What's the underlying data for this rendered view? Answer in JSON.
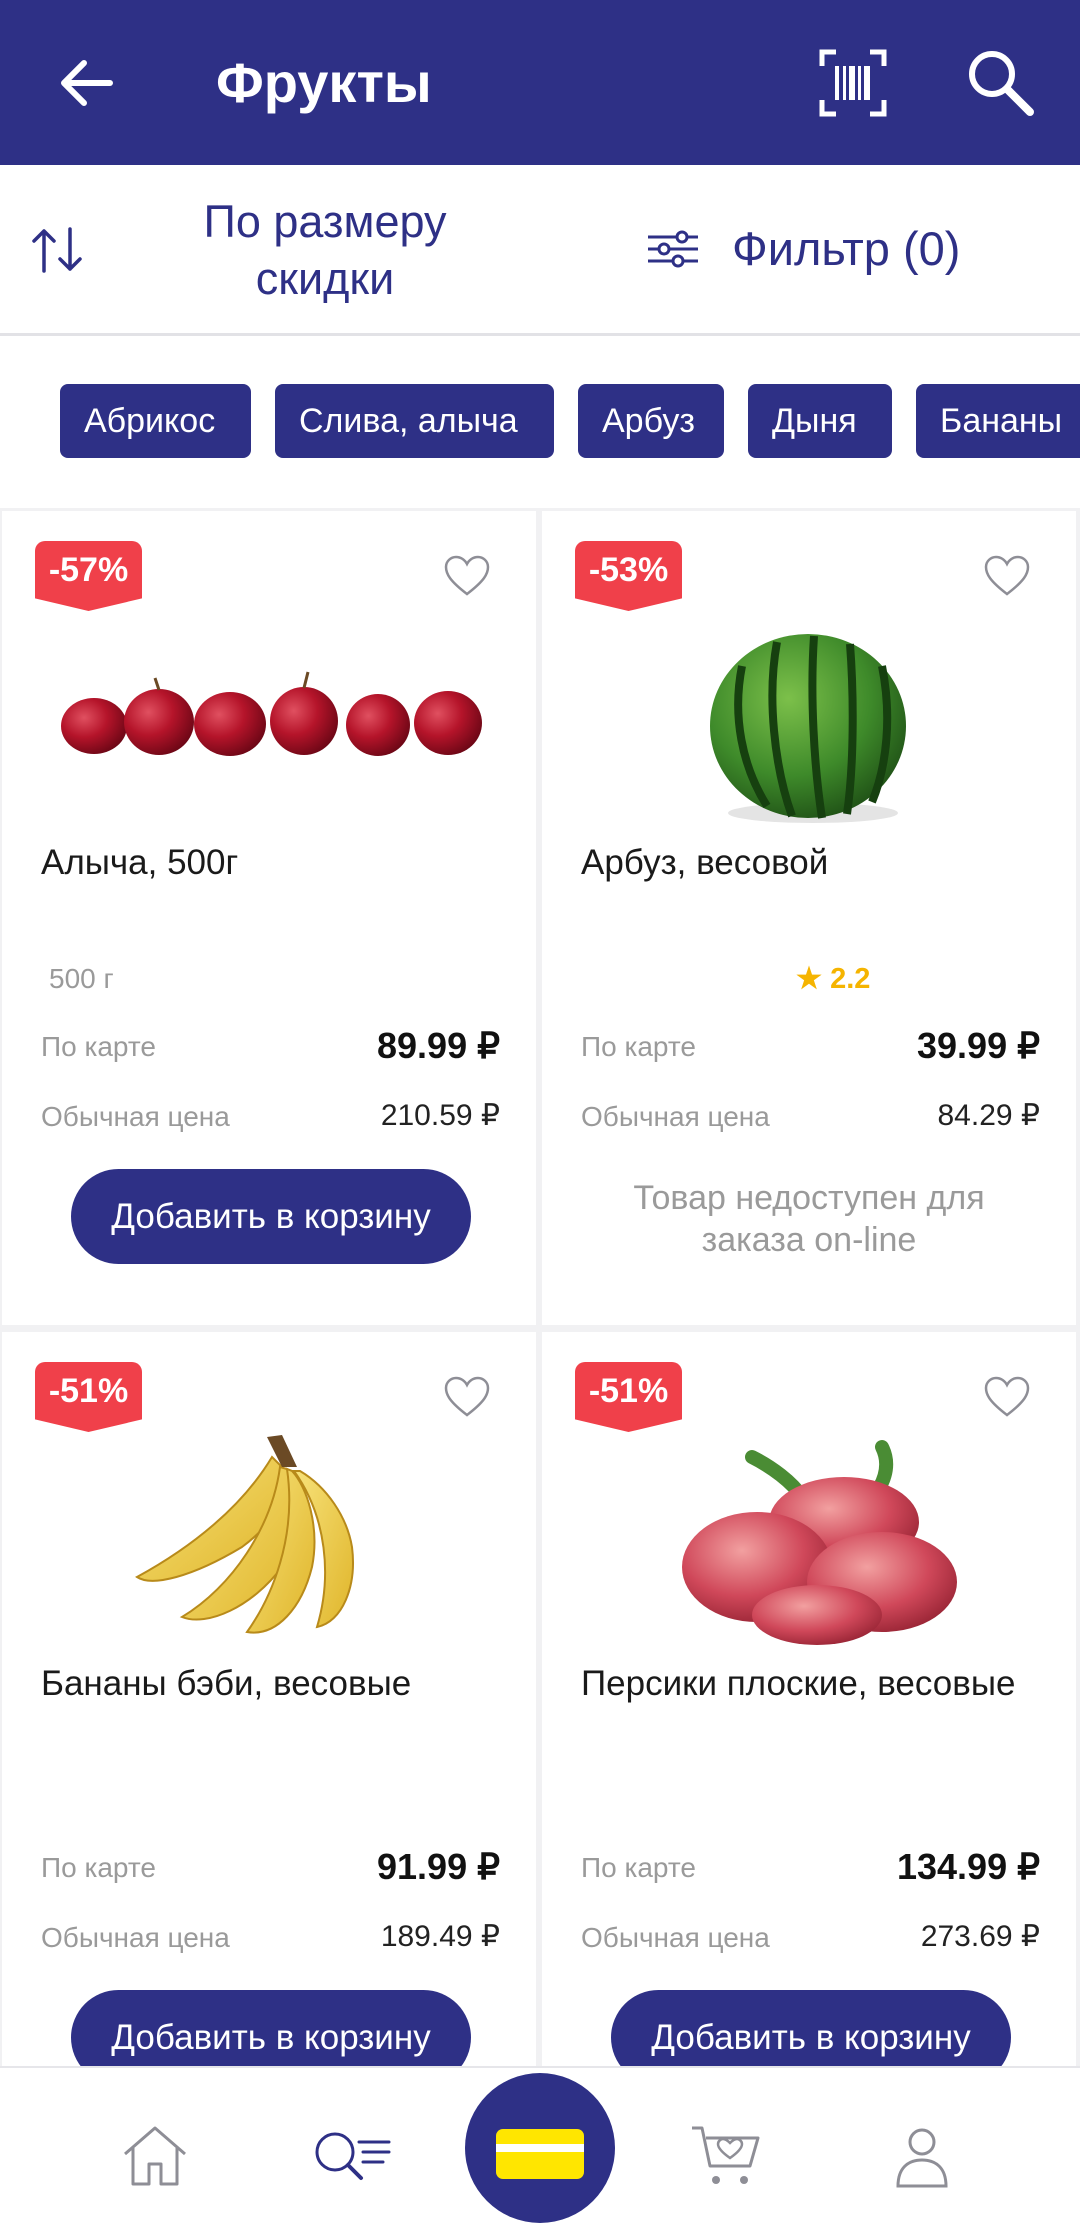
{
  "header": {
    "title": "Фрукты"
  },
  "toolbar": {
    "sort_label": "По размеру скидки",
    "filter_label": "Фильтр (0)"
  },
  "chips": [
    "Абрикос",
    "Слива, алыча",
    "Арбуз",
    "Дыня",
    "Бананы"
  ],
  "products": [
    {
      "badge": "-57%",
      "name": "Алыча, 500г",
      "weight": "500 г",
      "card_label": "По карте",
      "card_price": "89.99 ₽",
      "regular_label": "Обычная цена",
      "regular_price": "210.59 ₽",
      "action": "Добавить в корзину"
    },
    {
      "badge": "-53%",
      "name": "Арбуз, весовой",
      "rating": "2.2",
      "card_label": "По карте",
      "card_price": "39.99 ₽",
      "regular_label": "Обычная цена",
      "regular_price": "84.29 ₽",
      "unavailable": "Товар недоступен для заказа on-line"
    },
    {
      "badge": "-51%",
      "name": "Бананы бэби, весовые",
      "card_label": "По карте",
      "card_price": "91.99 ₽",
      "regular_label": "Обычная цена",
      "regular_price": "189.49 ₽",
      "action": "Добавить в корзину"
    },
    {
      "badge": "-51%",
      "name": "Персики плоские, весовые",
      "card_label": "По карте",
      "card_price": "134.99 ₽",
      "regular_label": "Обычная цена",
      "regular_price": "273.69 ₽",
      "action": "Добавить в корзину"
    }
  ],
  "nav": [
    "home-icon",
    "catalog-search-icon",
    "loyalty-card-icon",
    "cart-icon",
    "profile-icon"
  ],
  "colors": {
    "primary": "#2e3086",
    "badge": "#f0404a",
    "rating": "#f5b400",
    "card_yellow": "#ffe600"
  }
}
